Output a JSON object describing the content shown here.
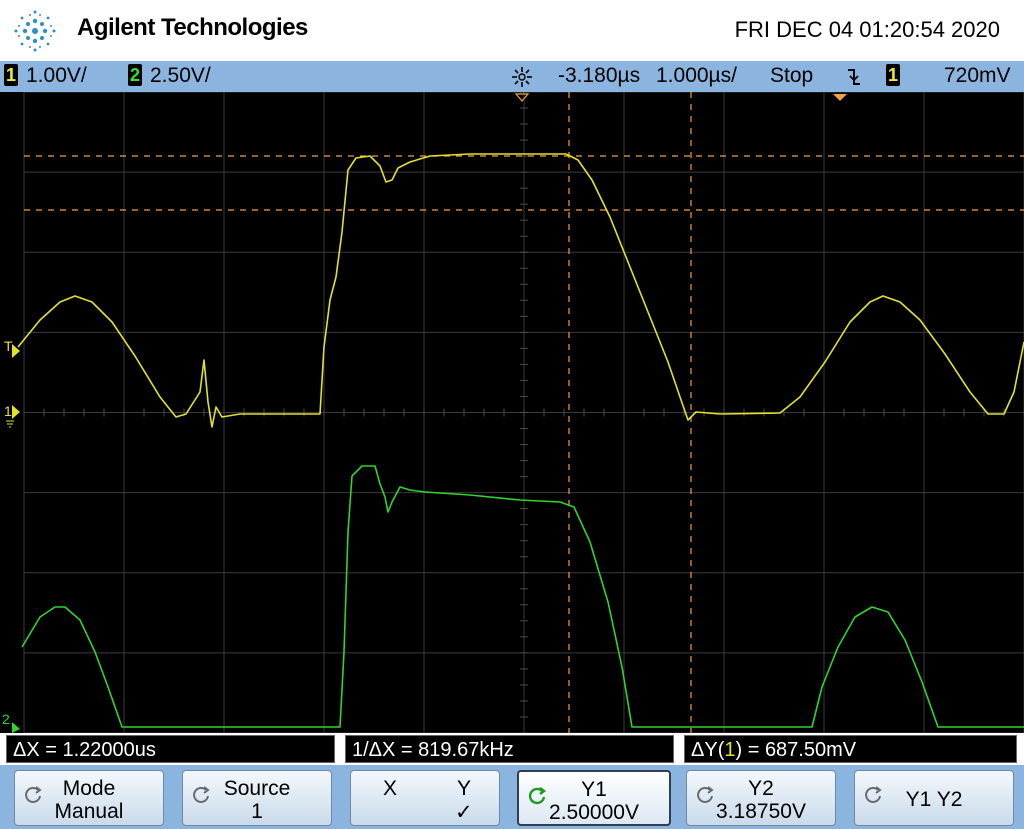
{
  "header": {
    "brand": "Agilent Technologies",
    "datetime": "FRI DEC 04 01:20:54 2020",
    "logo_icon": "agilent-spark-icon"
  },
  "status": {
    "ch1_num": "1",
    "ch1_scale": "1.00V/",
    "ch2_num": "2",
    "ch2_scale": "2.50V/",
    "delay": "-3.180µs",
    "timebase": "1.000µs/",
    "run_state": "Stop",
    "trigger_slope_icon": "falling-edge-icon",
    "trigger_source": "1",
    "trigger_level": "720mV"
  },
  "markers": {
    "trigger_level_T": "T",
    "ch1_ground": "1",
    "ch2_ground": "2"
  },
  "colors": {
    "ch1": "#e3e12a",
    "ch2": "#2fd42f",
    "cursor": "#f2a040",
    "grid": "#3a3a3a",
    "statusbar": "#8bb4de"
  },
  "measurements": {
    "delta_x": "ΔX = 1.22000us",
    "inv_delta_x": "1/ΔX = 819.67kHz",
    "delta_y_prefix": "ΔY(",
    "delta_y_ch": "1",
    "delta_y_suffix": ") = 687.50mV"
  },
  "softkeys": [
    {
      "line1": "Mode",
      "line2": "Manual"
    },
    {
      "line1": "Source",
      "line2": "1"
    },
    {
      "line1": "X",
      "line1b": "Y",
      "line2b": "✓"
    },
    {
      "line1": "Y1",
      "line2": "2.50000V"
    },
    {
      "line1": "Y2",
      "line2": "3.18750V"
    },
    {
      "line1": "Y1 Y2"
    }
  ]
}
